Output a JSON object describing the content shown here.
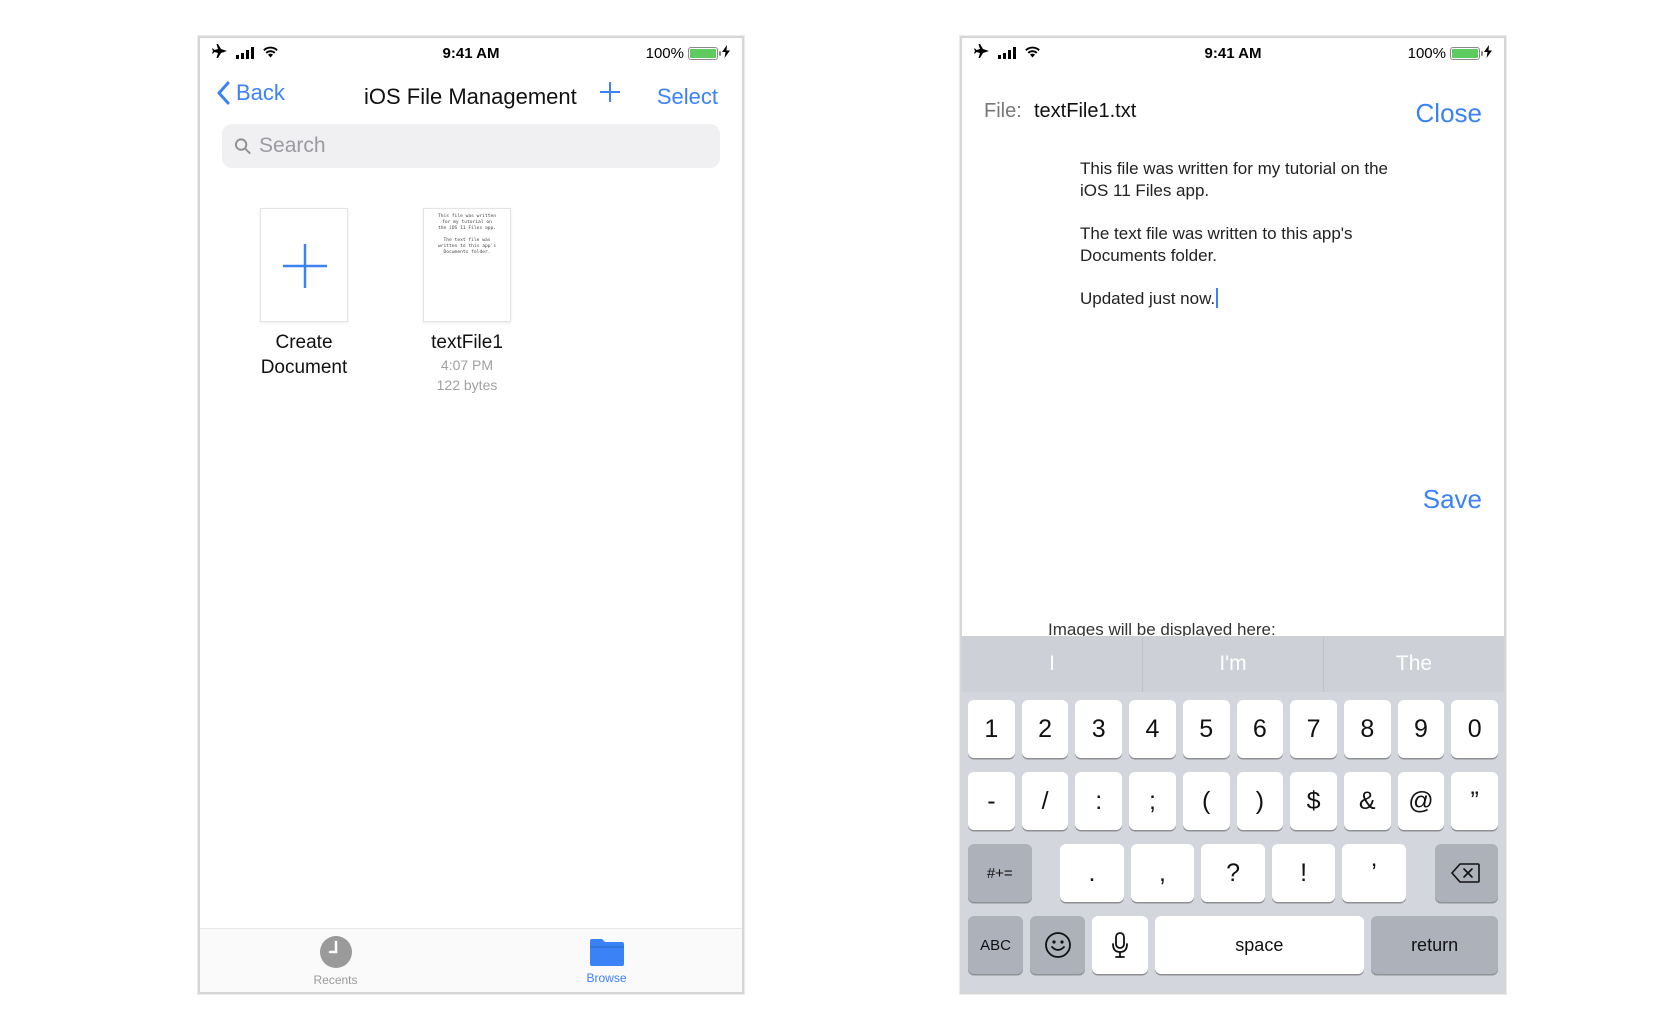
{
  "status": {
    "time": "9:41 AM",
    "battery": "100%"
  },
  "browser": {
    "back_label": "Back",
    "title": "iOS File Management",
    "add_label": "+",
    "select_label": "Select",
    "search_placeholder": "Search",
    "items": [
      {
        "label_line1": "Create",
        "label_line2": "Document"
      },
      {
        "label": "textFile1",
        "time": "4:07 PM",
        "size": "122 bytes",
        "preview": "This file was written\nfor my tutorial on\nthe iOS 11 Files app.\n\nThe text file was\nwritten to this app's\nDocuments folder."
      }
    ],
    "tabs": [
      {
        "label": "Recents",
        "icon": "clock-icon"
      },
      {
        "label": "Browse",
        "icon": "folder-icon"
      }
    ]
  },
  "editor": {
    "file_label": "File:",
    "file_name": "textFile1.txt",
    "close_label": "Close",
    "paragraphs": [
      "This file was written for my tutorial on the iOS 11 Files app.",
      "The text file was written to this app's Documents folder.",
      "Updated just now."
    ],
    "save_label": "Save",
    "images_note": "Images will be displayed here:"
  },
  "keyboard": {
    "predictions": [
      "I",
      "I'm",
      "The"
    ],
    "row1": [
      "1",
      "2",
      "3",
      "4",
      "5",
      "6",
      "7",
      "8",
      "9",
      "0"
    ],
    "row2": [
      "-",
      "/",
      ":",
      ";",
      "(",
      ")",
      "$",
      "&",
      "@",
      "”"
    ],
    "row3_left": "#+=",
    "row3": [
      ".",
      ",",
      "?",
      "!",
      "’"
    ],
    "abc": "ABC",
    "space": "space",
    "return": "return"
  },
  "colors": {
    "accent": "#3b82f6",
    "battery": "#5ecb5e",
    "keyboard_bg": "#d3d6dc"
  }
}
